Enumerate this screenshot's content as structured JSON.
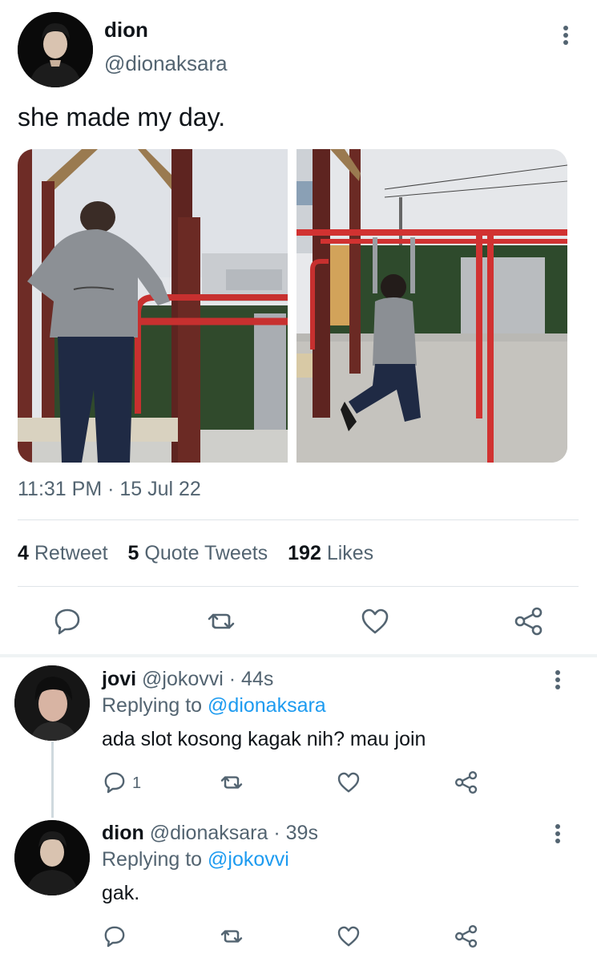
{
  "tweet": {
    "author_name": "dion",
    "author_handle": "@dionaksara",
    "text": "she made my day.",
    "timestamp": "11:31 PM · 15 Jul 22",
    "stats": {
      "retweet_count": "4",
      "retweet_label": "Retweet",
      "quote_count": "5",
      "quote_label": "Quote Tweets",
      "like_count": "192",
      "like_label": "Likes"
    }
  },
  "replies": [
    {
      "name": "jovi",
      "handle": "@jokovvi",
      "time": "· 44s",
      "replying_prefix": "Replying to",
      "replying_to": "@dionaksara",
      "text": "ada slot kosong kagak nih? mau join",
      "reply_count": "1"
    },
    {
      "name": "dion",
      "handle": "@dionaksara",
      "time": "· 39s",
      "replying_prefix": "Replying to",
      "replying_to": "@jokovvi",
      "text": "gak."
    }
  ],
  "icons": {
    "more": "more-vertical-icon",
    "reply": "reply-icon",
    "retweet": "retweet-icon",
    "like": "heart-icon",
    "share": "share-icon"
  },
  "colors": {
    "text_primary": "#0f1419",
    "text_secondary": "#536471",
    "link": "#1d9bf0",
    "divider": "#dfe4e8"
  }
}
